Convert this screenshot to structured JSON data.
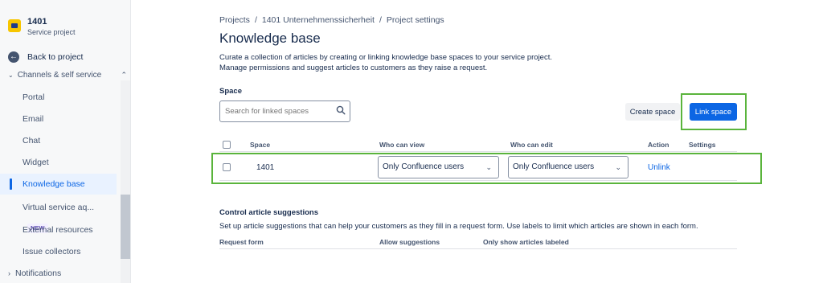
{
  "sidebar": {
    "project_name": "1401",
    "project_type": "Service project",
    "back_label": "Back to project",
    "section_label": "Channels & self service",
    "items": [
      {
        "label": "Portal"
      },
      {
        "label": "Email"
      },
      {
        "label": "Chat"
      },
      {
        "label": "Widget"
      },
      {
        "label": "Knowledge base"
      },
      {
        "label": "Virtual service aq...",
        "badge": "NEW"
      },
      {
        "label": "External resources"
      },
      {
        "label": "Issue collectors"
      }
    ],
    "notifications_label": "Notifications"
  },
  "breadcrumb": [
    "Projects",
    "1401 Unternehmenssicherheit",
    "Project settings"
  ],
  "breadcrumb_sep": "/",
  "page": {
    "title": "Knowledge base",
    "description_line1": "Curate a collection of articles by creating or linking knowledge base spaces to your service project.",
    "description_line2": "Manage permissions and suggest articles to customers as they raise a request."
  },
  "space": {
    "label": "Space",
    "search_placeholder": "Search for linked spaces",
    "create_button": "Create space",
    "link_button": "Link space"
  },
  "table": {
    "headers": {
      "space": "Space",
      "who_can_view": "Who can view",
      "who_can_edit": "Who can edit",
      "action": "Action",
      "settings": "Settings"
    },
    "rows": [
      {
        "space": "1401",
        "view": "Only Confluence users",
        "edit": "Only Confluence users",
        "action": "Unlink"
      }
    ]
  },
  "suggestions": {
    "title": "Control article suggestions",
    "description": "Set up article suggestions that can help your customers as they fill in a request form. Use labels to limit which articles are shown in each form.",
    "headers": {
      "request_form": "Request form",
      "allow": "Allow suggestions",
      "labeled": "Only show articles labeled"
    }
  },
  "colors": {
    "accent": "#0c66e4",
    "highlight": "#5ab43c"
  }
}
